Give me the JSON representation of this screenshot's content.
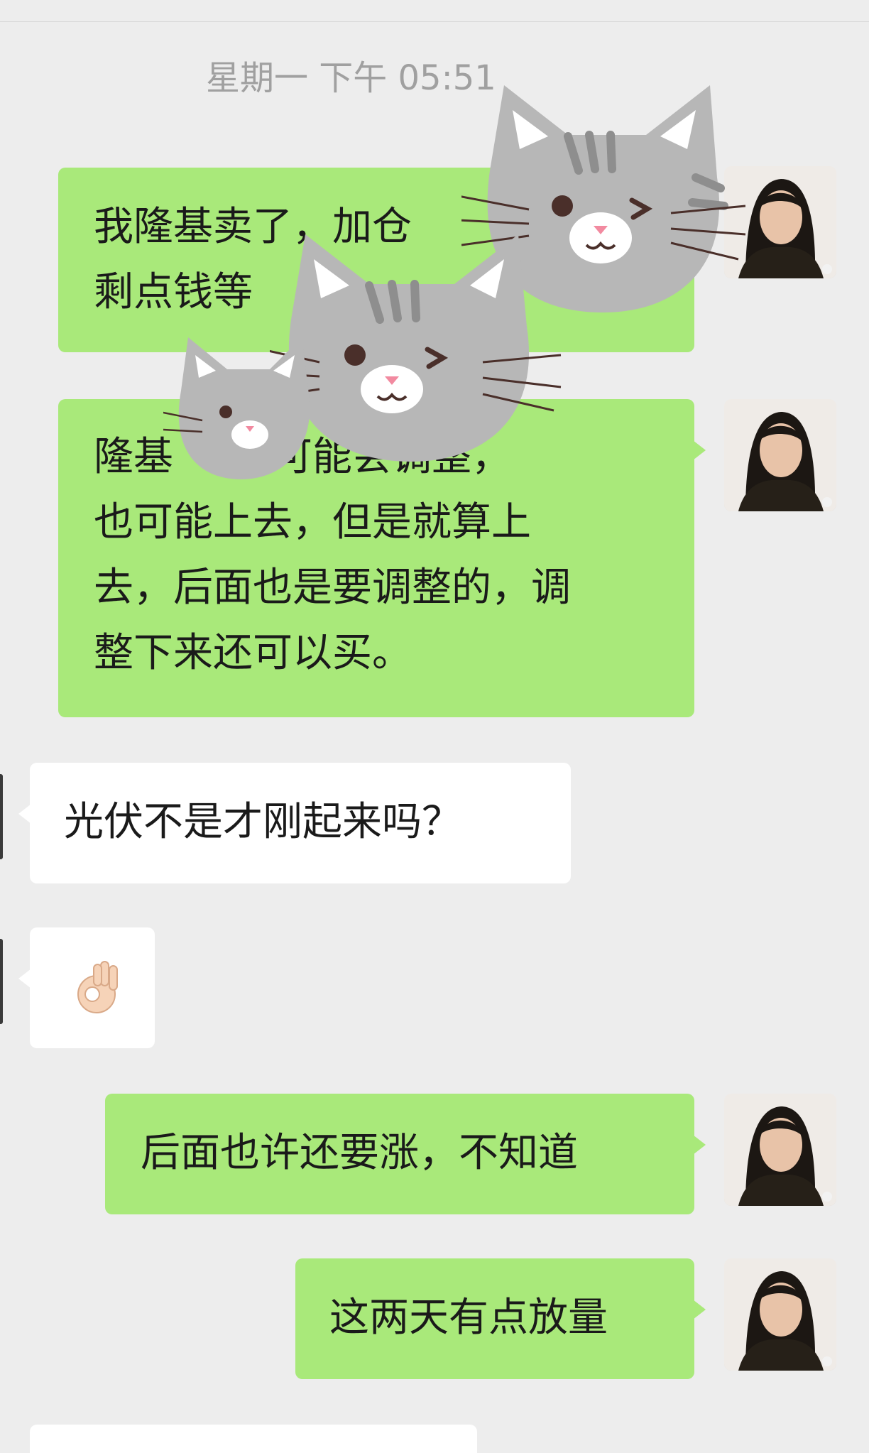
{
  "chat": {
    "timestamp": "星期一 下午 05:51",
    "messages": [
      {
        "side": "me",
        "lines": [
          "我隆基卖了，加仓",
          "剩点钱等"
        ]
      },
      {
        "side": "me",
        "lines": [
          "隆基",
          "也可能上去，但是就算上",
          "去，后面也是要调整的，调",
          "整下来还可以买。"
        ],
        "partial_first_line": "可能会调整，"
      },
      {
        "side": "them",
        "text": "光伏不是才刚起来吗？"
      },
      {
        "side": "them",
        "emoji": "👌",
        "emoji_name": "ok-hand-icon"
      },
      {
        "side": "me",
        "text": "后面也许还要涨，不知道"
      },
      {
        "side": "me",
        "text": "这两天有点放量"
      }
    ]
  },
  "colors": {
    "background": "#ededed",
    "my_bubble": "#a9e97a",
    "their_bubble": "#ffffff",
    "timestamp_text": "#a0a0a0",
    "sticker_fur": "#b5b5b5",
    "sticker_stripe": "#8c8c8c"
  },
  "stickers": [
    "cat-sticker-icon",
    "cat-sticker-icon",
    "cat-sticker-icon"
  ]
}
